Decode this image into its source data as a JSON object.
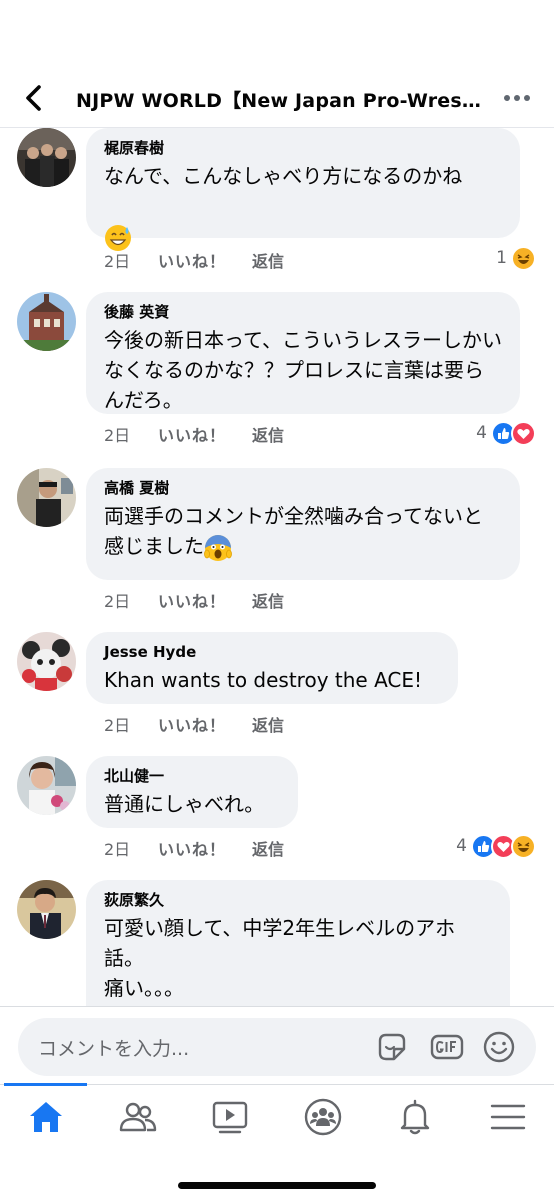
{
  "header": {
    "title": "NJPW WORLD【New Japan Pro-Wrestli..."
  },
  "comments": [
    {
      "author": "梶原春樹",
      "text": "なんで、こんなしゃべり方になるのかね",
      "emoji": "sweat-smile",
      "time": "2日",
      "like_label": "いいね！",
      "reply_label": "返信",
      "reaction_count": "1",
      "reactions": [
        "haha"
      ]
    },
    {
      "author": "後藤 英資",
      "text": "今後の新日本って、こういうレスラーしかいなくなるのかな？？プロレスに言葉は要らんだろ。",
      "time": "2日",
      "like_label": "いいね！",
      "reply_label": "返信",
      "reaction_count": "4",
      "reactions": [
        "like",
        "love"
      ]
    },
    {
      "author": "高橋 夏樹",
      "text": "両選手のコメントが全然噛み合ってないと感じました",
      "emoji": "scream",
      "time": "2日",
      "like_label": "いいね！",
      "reply_label": "返信"
    },
    {
      "author": "Jesse Hyde",
      "text": "Khan wants to destroy the ACE!",
      "time": "2日",
      "like_label": "いいね！",
      "reply_label": "返信"
    },
    {
      "author": "北山健一",
      "text": "普通にしゃべれ。",
      "time": "2日",
      "like_label": "いいね！",
      "reply_label": "返信",
      "reaction_count": "4",
      "reactions": [
        "like",
        "love",
        "haha"
      ]
    },
    {
      "author": "荻原繁久",
      "text": "可愛い顔して、中学2年生レベルのアホ話。\n痛い。。。"
    }
  ],
  "composer": {
    "placeholder": "コメントを入力..."
  },
  "nav": {
    "items": [
      "home-icon",
      "friends-icon",
      "watch-icon",
      "groups-icon",
      "notifications-icon",
      "menu-icon"
    ],
    "active": "home-icon"
  },
  "colors": {
    "accent": "#1877f2",
    "bubble": "#f0f2f5",
    "secondary_text": "#65676b",
    "love": "#f33e58",
    "haha": "#f7b125"
  }
}
